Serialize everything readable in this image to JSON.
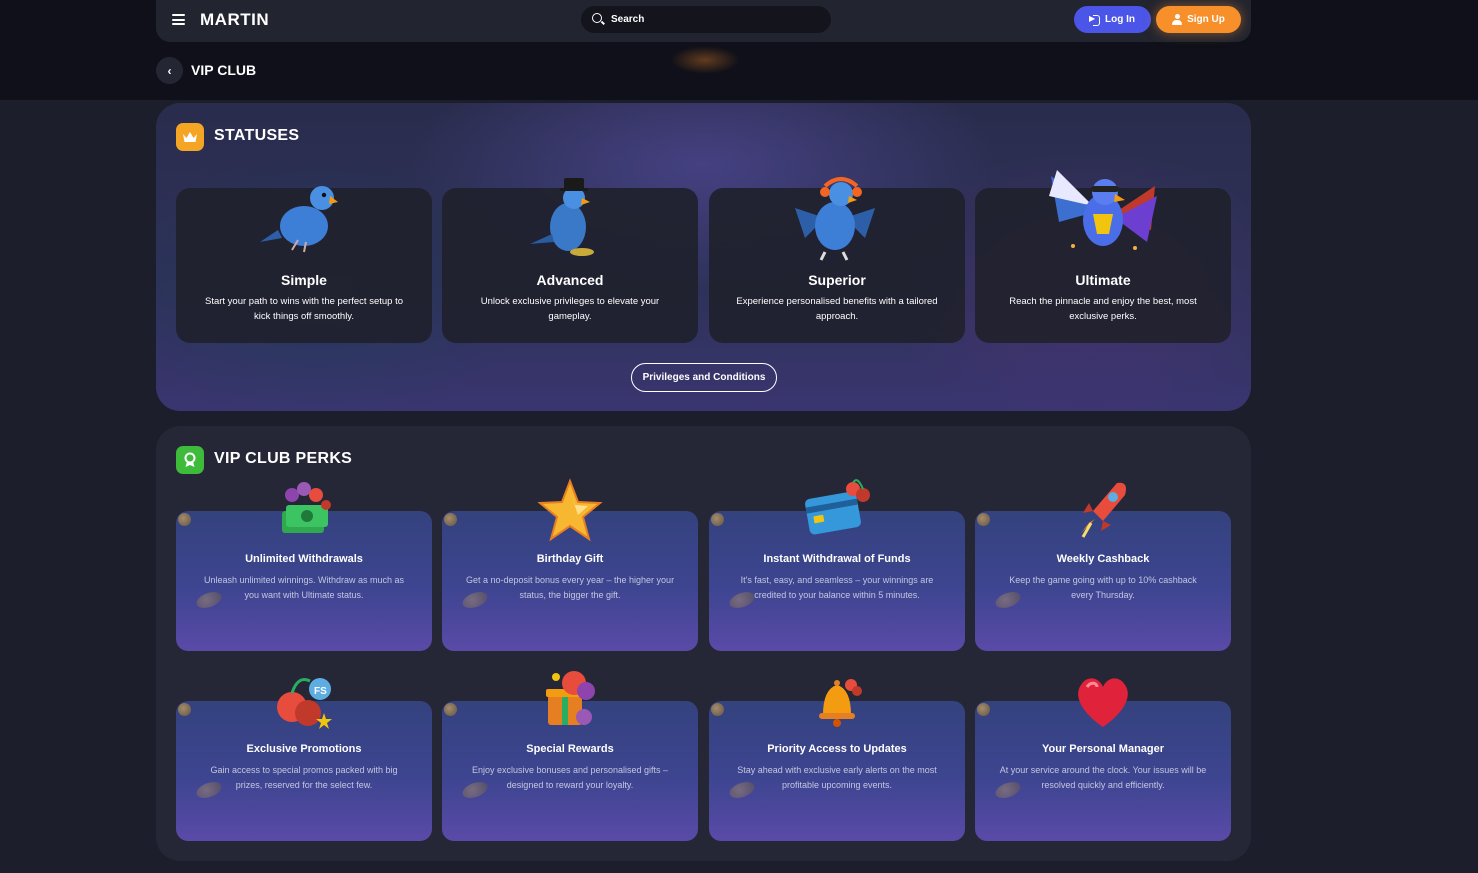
{
  "header": {
    "logo": "MARTIN",
    "search_placeholder": "Search",
    "login_label": "Log In",
    "signup_label": "Sign Up"
  },
  "breadcrumb": {
    "title": "VIP CLUB"
  },
  "statuses": {
    "title": "STATUSES",
    "cards": [
      {
        "name": "Simple",
        "desc": "Start your path to wins with the perfect setup to kick things off smoothly."
      },
      {
        "name": "Advanced",
        "desc": "Unlock exclusive privileges to elevate your gameplay."
      },
      {
        "name": "Superior",
        "desc": "Experience personalised benefits with a tailored approach."
      },
      {
        "name": "Ultimate",
        "desc": "Reach the pinnacle and enjoy the best, most exclusive perks."
      }
    ],
    "button_label": "Privileges and Conditions"
  },
  "perks": {
    "title": "VIP CLUB PERKS",
    "cards": [
      {
        "title": "Unlimited Withdrawals",
        "desc": "Unleash unlimited winnings. Withdraw as much as you want with Ultimate status.",
        "icon": "money-stack-icon"
      },
      {
        "title": "Birthday Gift",
        "desc": "Get a no-deposit bonus every year – the higher your status, the bigger the gift.",
        "icon": "star-icon"
      },
      {
        "title": "Instant Withdrawal of Funds",
        "desc": "It's fast, easy, and seamless – your winnings are credited to your balance within 5 minutes.",
        "icon": "credit-card-icon"
      },
      {
        "title": "Weekly Cashback",
        "desc": "Keep the game going with up to 10% cashback every Thursday.",
        "icon": "rocket-icon"
      },
      {
        "title": "Exclusive Promotions",
        "desc": "Gain access to special promos packed with big prizes, reserved for the select few.",
        "icon": "cherries-icon"
      },
      {
        "title": "Special Rewards",
        "desc": "Enjoy exclusive bonuses and personalised gifts – designed to reward your loyalty.",
        "icon": "gift-icon"
      },
      {
        "title": "Priority Access to Updates",
        "desc": "Stay ahead with exclusive early alerts on the most profitable upcoming events.",
        "icon": "bell-icon"
      },
      {
        "title": "Your Personal Manager",
        "desc": "At your service around the clock. Your issues will be resolved quickly and efficiently.",
        "icon": "heart-icon"
      }
    ]
  },
  "colors": {
    "accent_orange": "#f7902b",
    "accent_blue": "#4b55e8",
    "background": "#1c1e2c"
  }
}
